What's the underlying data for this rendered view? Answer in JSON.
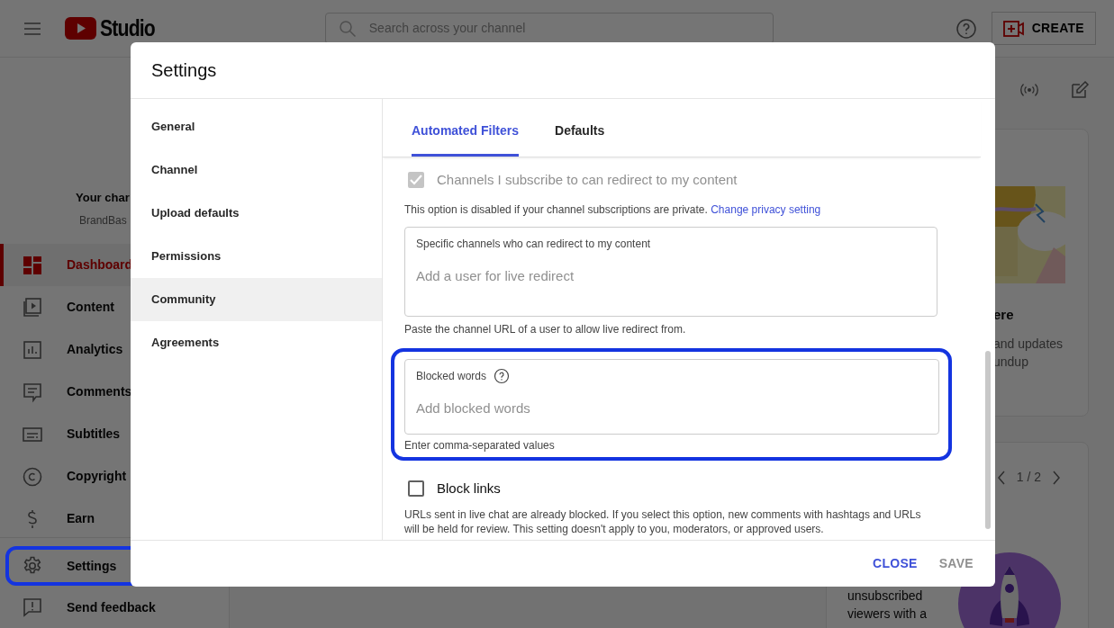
{
  "app": {
    "logo_text": "Studio",
    "search": {
      "placeholder": "Search across your channel"
    },
    "create_button": "CREATE"
  },
  "sidebar": {
    "channel_title": "Your char",
    "channel_name": "BrandBas",
    "items": [
      {
        "label": "Dashboard",
        "kind": "dashboard",
        "selected": true,
        "highlighted": false
      },
      {
        "label": "Content",
        "kind": "content",
        "selected": false,
        "highlighted": false
      },
      {
        "label": "Analytics",
        "kind": "analytics",
        "selected": false,
        "highlighted": false
      },
      {
        "label": "Comments",
        "kind": "comments",
        "selected": false,
        "highlighted": false
      },
      {
        "label": "Subtitles",
        "kind": "subtitles",
        "selected": false,
        "highlighted": false
      },
      {
        "label": "Copyright",
        "kind": "copyright",
        "selected": false,
        "highlighted": false
      },
      {
        "label": "Earn",
        "kind": "earn",
        "selected": false,
        "highlighted": false
      }
    ],
    "footer_items": [
      {
        "label": "Settings",
        "kind": "settings",
        "selected": false,
        "highlighted": true
      },
      {
        "label": "Send feedback",
        "kind": "feedback",
        "selected": false,
        "highlighted": false
      }
    ]
  },
  "dashboard": {
    "news_card": {
      "title": "ere",
      "lines": [
        "and updates",
        "undup"
      ]
    },
    "promo_card": {
      "pager": "1 / 2",
      "lines": [
        "unsubscribed",
        "viewers with a"
      ]
    }
  },
  "dialog": {
    "title": "Settings",
    "nav": [
      {
        "label": "General",
        "selected": false
      },
      {
        "label": "Channel",
        "selected": false
      },
      {
        "label": "Upload defaults",
        "selected": false
      },
      {
        "label": "Permissions",
        "selected": false
      },
      {
        "label": "Community",
        "selected": true
      },
      {
        "label": "Agreements",
        "selected": false
      }
    ],
    "tabs": [
      {
        "label": "Automated Filters",
        "selected": true
      },
      {
        "label": "Defaults",
        "selected": false
      }
    ],
    "content": [
      {
        "kind": "checkbox",
        "label": "Channels I subscribe to can redirect to my content",
        "checked": true,
        "disabled": true,
        "help": "This option is disabled if your channel subscriptions are private.",
        "link": "Change privacy setting"
      },
      {
        "kind": "textarea",
        "label": "Specific channels who can redirect to my content",
        "placeholder": "Add a user for live redirect",
        "help": "Paste the channel URL of a user to allow live redirect from.",
        "info_icon": false,
        "highlighted": false
      },
      {
        "kind": "textarea",
        "label": "Blocked words",
        "placeholder": "Add blocked words",
        "help": "Enter comma-separated values",
        "info_icon": true,
        "highlighted": true
      },
      {
        "kind": "checkbox",
        "label": "Block links",
        "checked": false,
        "disabled": false,
        "help": "URLs sent in live chat are already blocked. If you select this option, new comments with hashtags and URLs will be held for review. This setting doesn't apply to you, moderators, or approved users."
      }
    ],
    "actions": [
      {
        "label": "CLOSE",
        "disabled": false
      },
      {
        "label": "SAVE",
        "disabled": true
      }
    ]
  }
}
